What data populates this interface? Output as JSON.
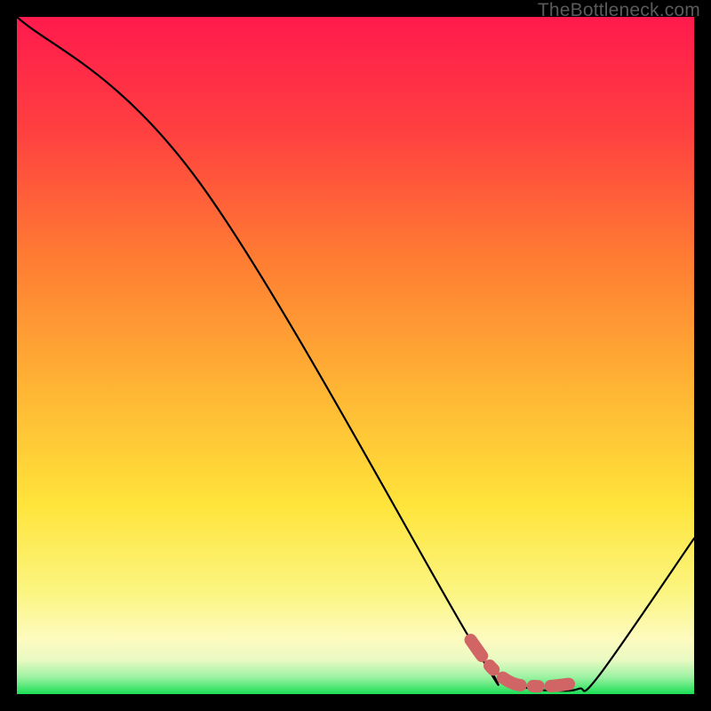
{
  "watermark": "TheBottleneck.com",
  "colors": {
    "top": "#ff1a4d",
    "orange": "#ff7a33",
    "yellow": "#ffe43a",
    "paleyellow": "#fdfbc0",
    "green": "#1adf55",
    "curve": "#000000",
    "dashed": "#d16464"
  },
  "chart_data": {
    "type": "line",
    "title": "",
    "xlabel": "",
    "ylabel": "",
    "xlim": [
      0,
      100
    ],
    "ylim": [
      0,
      100
    ],
    "grid": false,
    "legend": false,
    "annotations": [],
    "series": [
      {
        "name": "curve",
        "style": "solid",
        "color": "#000000",
        "points": [
          {
            "x": 0.0,
            "y": 100.0
          },
          {
            "x": 27.0,
            "y": 75.5
          },
          {
            "x": 67.0,
            "y": 8.0
          },
          {
            "x": 70.0,
            "y": 4.0
          },
          {
            "x": 73.0,
            "y": 1.7
          },
          {
            "x": 76.0,
            "y": 0.8
          },
          {
            "x": 80.0,
            "y": 0.5
          },
          {
            "x": 83.0,
            "y": 0.8
          },
          {
            "x": 86.0,
            "y": 2.8
          },
          {
            "x": 100.0,
            "y": 23.0
          }
        ]
      },
      {
        "name": "optimal-zone",
        "style": "dashed",
        "color": "#d16464",
        "points": [
          {
            "x": 67.0,
            "y": 8.0
          },
          {
            "x": 70.0,
            "y": 4.0
          },
          {
            "x": 73.0,
            "y": 1.7
          },
          {
            "x": 76.0,
            "y": 1.2
          },
          {
            "x": 79.0,
            "y": 1.2
          },
          {
            "x": 81.5,
            "y": 1.5
          }
        ]
      }
    ]
  }
}
